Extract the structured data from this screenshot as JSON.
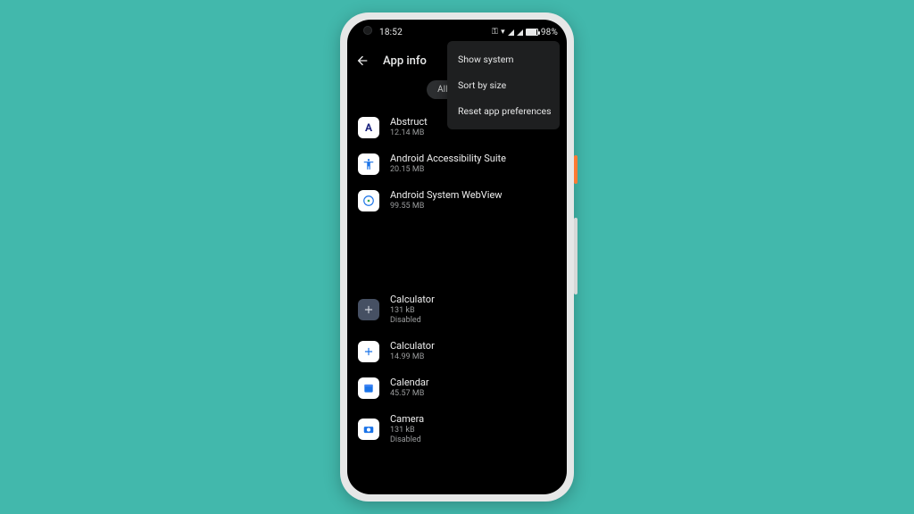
{
  "statusbar": {
    "time": "18:52",
    "battery": "98%"
  },
  "header": {
    "title": "App info"
  },
  "filter_chip": {
    "label": "All apps"
  },
  "menu": {
    "items": [
      {
        "label": "Show system"
      },
      {
        "label": "Sort by size"
      },
      {
        "label": "Reset app preferences"
      }
    ]
  },
  "apps": [
    {
      "name": "Abstruct",
      "size": "12.14 MB",
      "status": "",
      "icon": "abstruct"
    },
    {
      "name": "Android Accessibility Suite",
      "size": "20.15 MB",
      "status": "",
      "icon": "access"
    },
    {
      "name": "Android System WebView",
      "size": "99.55 MB",
      "status": "",
      "icon": "webview"
    },
    {
      "name": "Calculator",
      "size": "131 kB",
      "status": "Disabled",
      "icon": "calc1"
    },
    {
      "name": "Calculator",
      "size": "14.99 MB",
      "status": "",
      "icon": "calc2"
    },
    {
      "name": "Calendar",
      "size": "45.57 MB",
      "status": "",
      "icon": "calendar"
    },
    {
      "name": "Camera",
      "size": "131 kB",
      "status": "Disabled",
      "icon": "camera"
    }
  ]
}
